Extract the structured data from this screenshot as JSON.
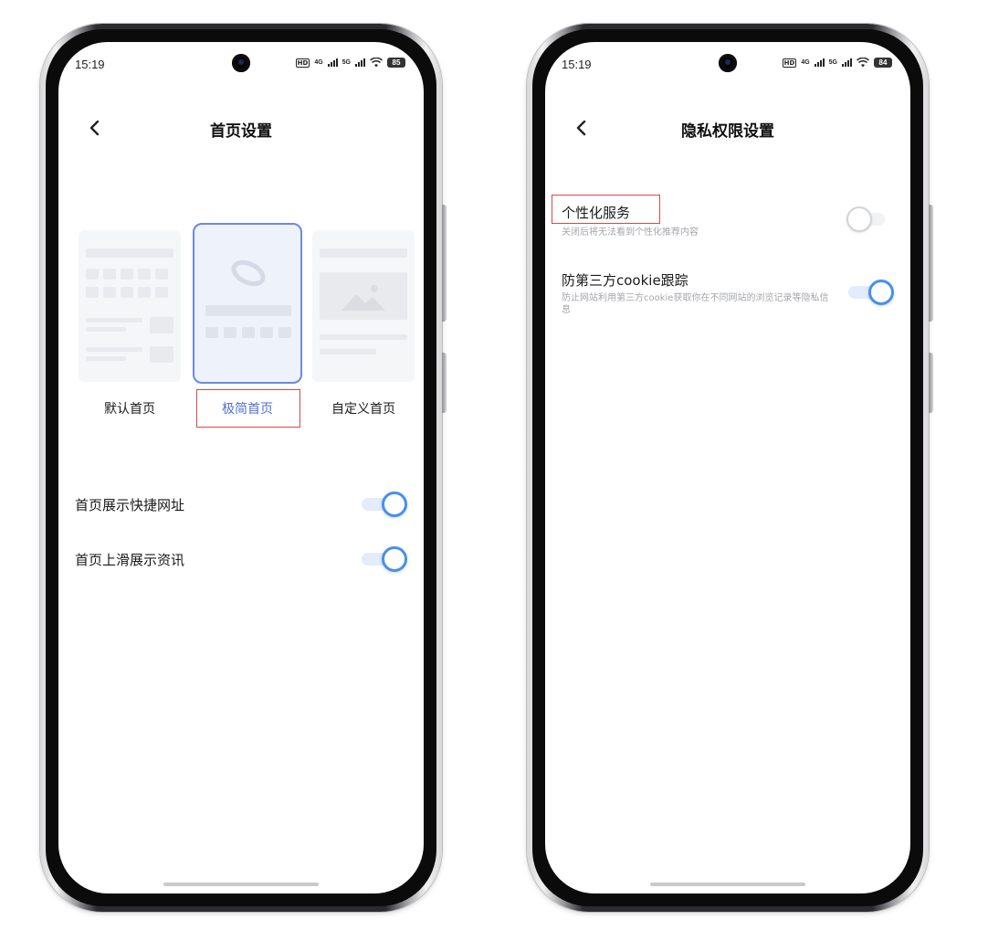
{
  "left_screen": {
    "status": {
      "time": "15:19",
      "signal1": "4G",
      "signal2": "5G",
      "hd": "HD",
      "battery": "85"
    },
    "header": {
      "title": "首页设置"
    },
    "homepage_options": [
      {
        "label": "默认首页",
        "selected": false
      },
      {
        "label": "极简首页",
        "selected": true
      },
      {
        "label": "自定义首页",
        "selected": false
      }
    ],
    "settings": [
      {
        "label": "首页展示快捷网址",
        "enabled": true
      },
      {
        "label": "首页上滑展示资讯",
        "enabled": true
      }
    ]
  },
  "right_screen": {
    "status": {
      "time": "15:19",
      "signal1": "4G",
      "signal2": "5G",
      "hd": "HD",
      "battery": "84"
    },
    "header": {
      "title": "隐私权限设置"
    },
    "settings": [
      {
        "title": "个性化服务",
        "description": "关闭后将无法看到个性化推荐内容",
        "enabled": false
      },
      {
        "title": "防第三方cookie跟踪",
        "description": "防止网站利用第三方cookie获取你在不同网站的浏览记录等隐私信息",
        "enabled": true
      }
    ]
  },
  "colors": {
    "accent": "#4a90e6",
    "selected_label": "#4e6fd8",
    "highlight_box": "#d44a4a"
  }
}
